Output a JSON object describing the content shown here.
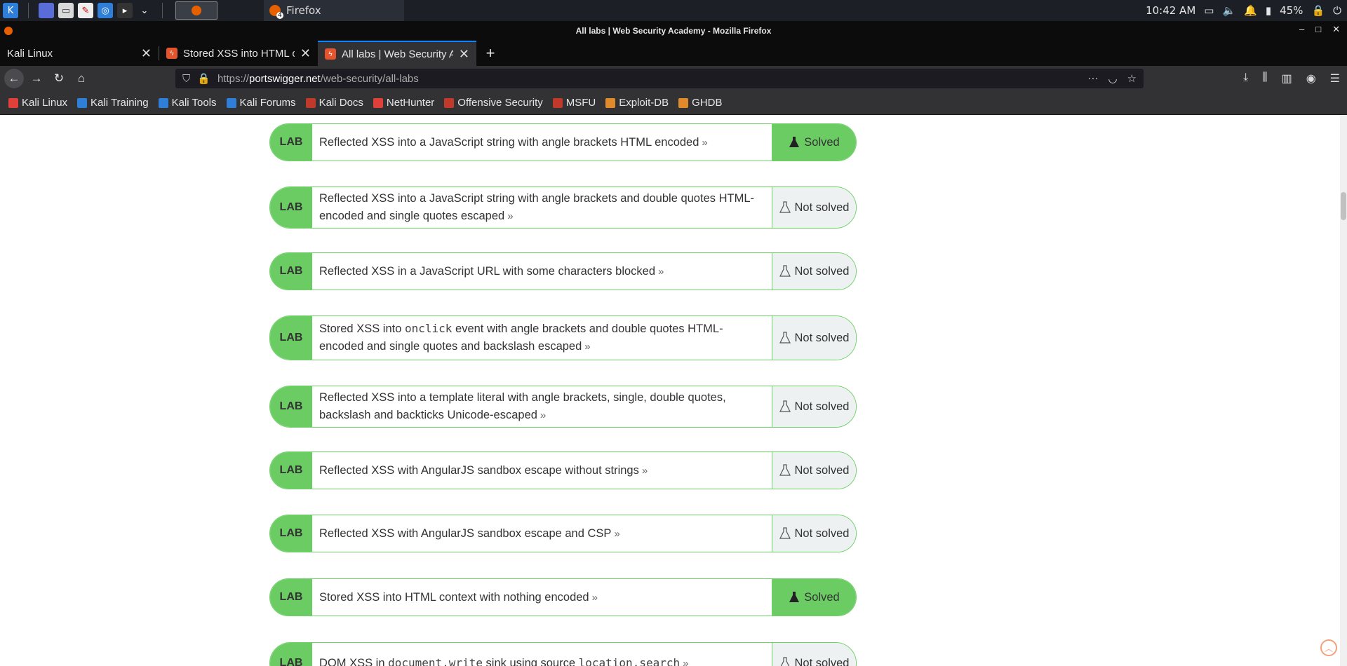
{
  "taskbar": {
    "task_label": "Firefox",
    "task_badge": "4",
    "clock": "10:42 AM",
    "battery": "45%"
  },
  "window": {
    "title": "All labs | Web Security Academy - Mozilla Firefox"
  },
  "tabs": [
    {
      "label": "Kali Linux",
      "active": false
    },
    {
      "label": "Stored XSS into HTML co",
      "active": false
    },
    {
      "label": "All labs | Web Security Ac",
      "active": true
    }
  ],
  "url": {
    "scheme": "https://",
    "host": "portswigger.net",
    "path": "/web-security/all-labs"
  },
  "bookmarks": [
    {
      "label": "Kali Linux",
      "icon": "kali-icon",
      "color": "#e0403a"
    },
    {
      "label": "Kali Training",
      "icon": "kali-icon",
      "color": "#2f7fd8"
    },
    {
      "label": "Kali Tools",
      "icon": "kali-icon",
      "color": "#2f7fd8"
    },
    {
      "label": "Kali Forums",
      "icon": "kali-icon",
      "color": "#2f7fd8"
    },
    {
      "label": "Kali Docs",
      "icon": "kali-docs-icon",
      "color": "#c0392b"
    },
    {
      "label": "NetHunter",
      "icon": "nethunter-icon",
      "color": "#e0403a"
    },
    {
      "label": "Offensive Security",
      "icon": "offsec-icon",
      "color": "#c0392b"
    },
    {
      "label": "MSFU",
      "icon": "msfu-icon",
      "color": "#c0392b"
    },
    {
      "label": "Exploit-DB",
      "icon": "exploitdb-icon",
      "color": "#e08a2c"
    },
    {
      "label": "GHDB",
      "icon": "ghdb-icon",
      "color": "#e08a2c"
    }
  ],
  "labs": [
    {
      "badge": "LAB",
      "parts": [
        "Reflected XSS into a JavaScript string with angle brackets HTML encoded"
      ],
      "status": "Solved"
    },
    {
      "badge": "LAB",
      "parts": [
        "Reflected XSS into a JavaScript string with angle brackets and double quotes HTML-encoded and single quotes escaped"
      ],
      "status": "Not solved"
    },
    {
      "badge": "LAB",
      "parts": [
        "Reflected XSS in a JavaScript URL with some characters blocked"
      ],
      "status": "Not solved"
    },
    {
      "badge": "LAB",
      "parts": [
        "Stored XSS into ",
        "onclick",
        " event with angle brackets and double quotes HTML-encoded and single quotes and backslash escaped"
      ],
      "status": "Not solved"
    },
    {
      "badge": "LAB",
      "parts": [
        "Reflected XSS into a template literal with angle brackets, single, double quotes, backslash and backticks Unicode-escaped"
      ],
      "status": "Not solved"
    },
    {
      "badge": "LAB",
      "parts": [
        "Reflected XSS with AngularJS sandbox escape without strings"
      ],
      "status": "Not solved"
    },
    {
      "badge": "LAB",
      "parts": [
        "Reflected XSS with AngularJS sandbox escape and CSP"
      ],
      "status": "Not solved"
    },
    {
      "badge": "LAB",
      "parts": [
        "Stored XSS into HTML context with nothing encoded"
      ],
      "status": "Solved"
    },
    {
      "badge": "LAB",
      "parts": [
        "DOM XSS in ",
        "document.write",
        " sink using source ",
        "location.search"
      ],
      "status": "Not solved"
    }
  ],
  "colors": {
    "lab_green": "#6ccc64",
    "lab_border": "#70d16a",
    "not_solved_bg": "#eef1f1"
  }
}
